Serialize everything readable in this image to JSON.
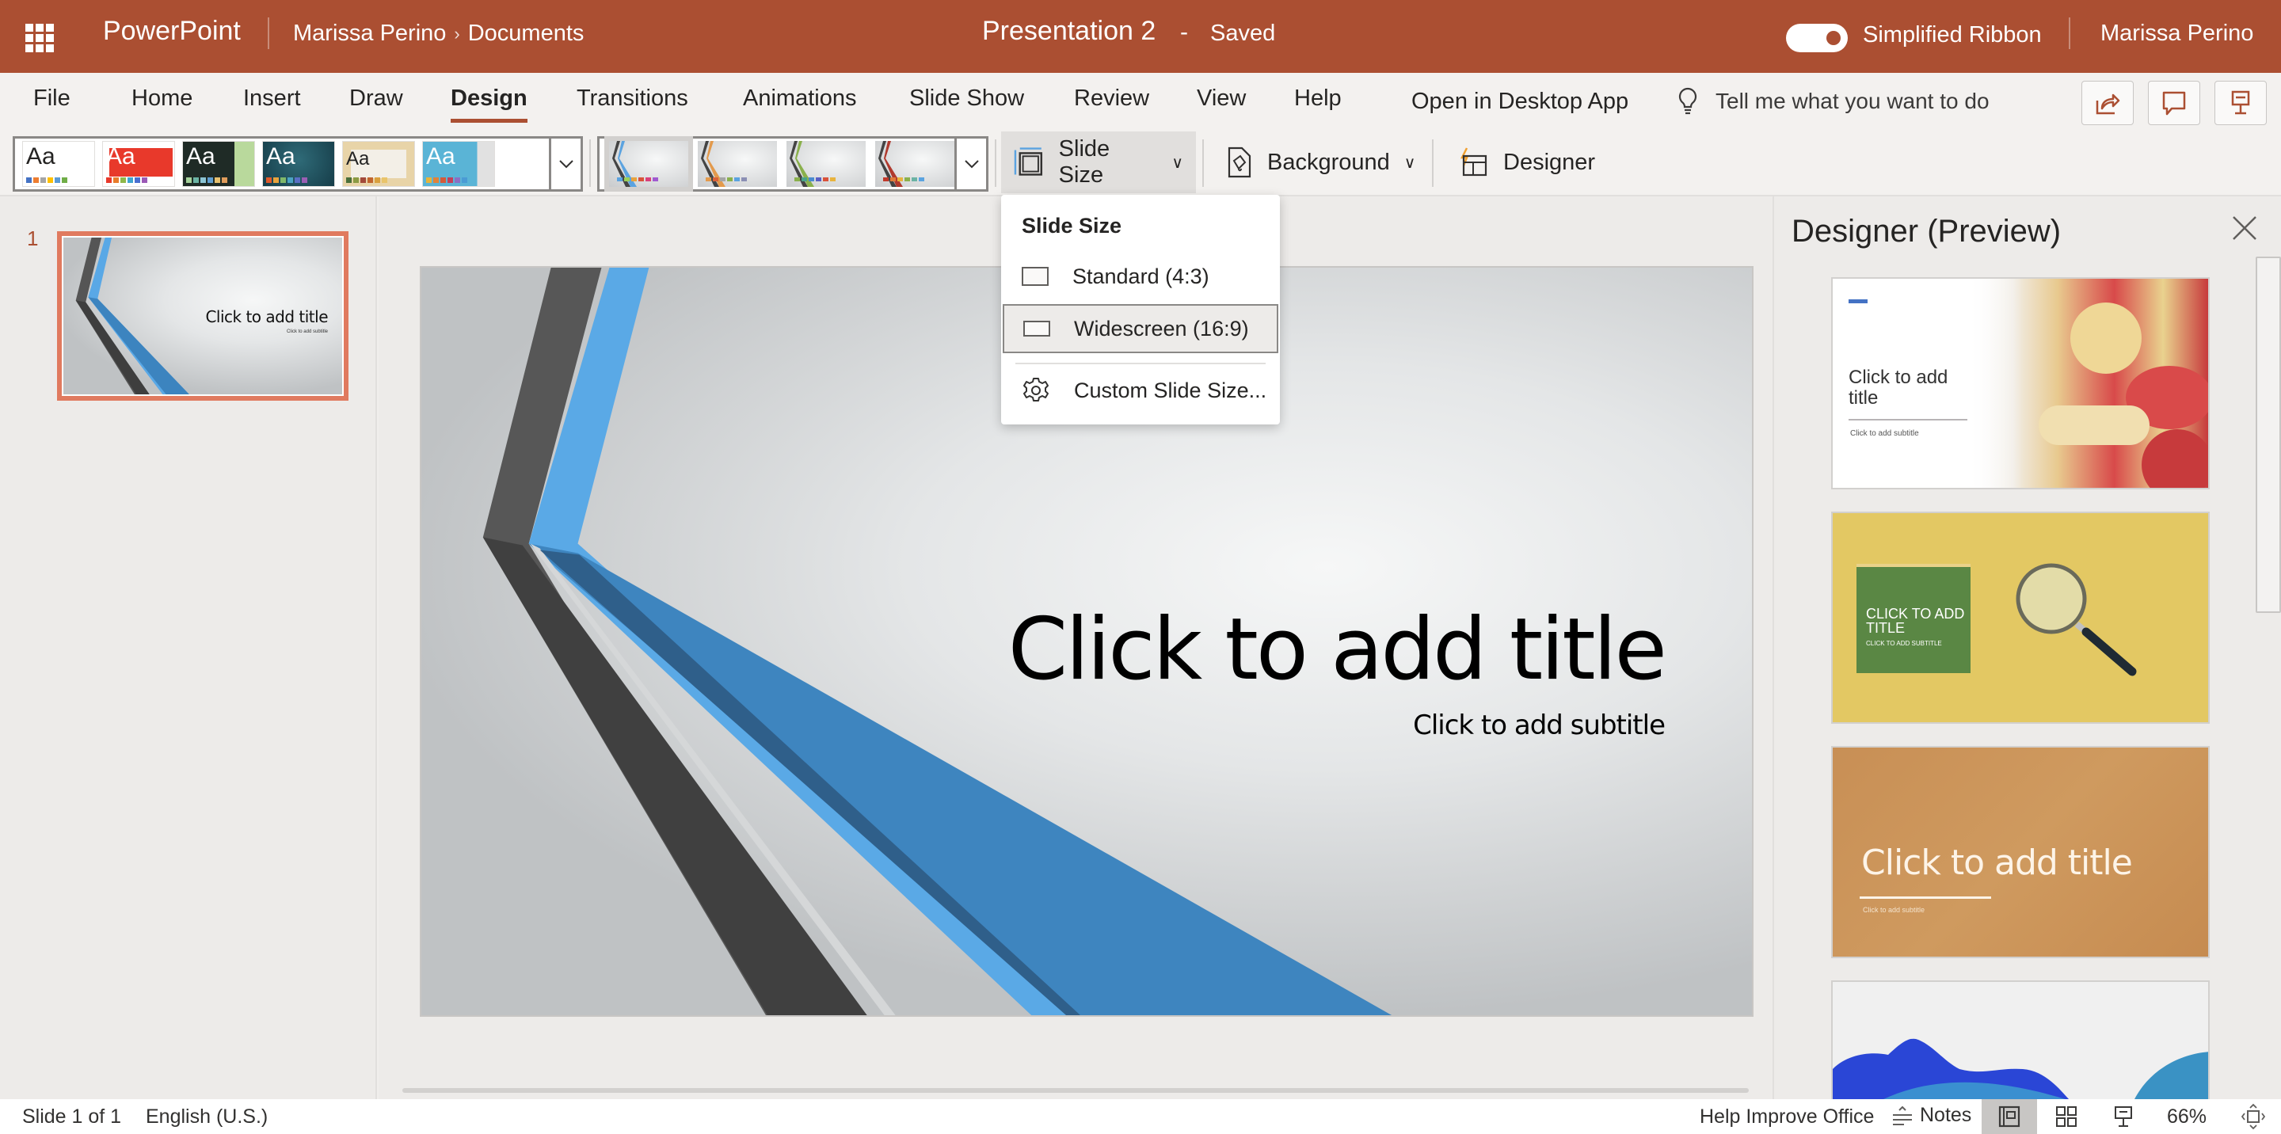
{
  "titlebar": {
    "app_name": "PowerPoint",
    "breadcrumb": [
      "Marissa Perino",
      "Documents"
    ],
    "doc_title": "Presentation 2",
    "separator": "-",
    "save_status": "Saved",
    "simplified_ribbon_label": "Simplified Ribbon",
    "simplified_ribbon_on": true,
    "user_name": "Marissa Perino",
    "brand_color": "#ab4f32"
  },
  "tabs": {
    "items": [
      {
        "label": "File"
      },
      {
        "label": "Home"
      },
      {
        "label": "Insert"
      },
      {
        "label": "Draw"
      },
      {
        "label": "Design",
        "active": true
      },
      {
        "label": "Transitions"
      },
      {
        "label": "Animations"
      },
      {
        "label": "Slide Show"
      },
      {
        "label": "Review"
      },
      {
        "label": "View"
      },
      {
        "label": "Help"
      },
      {
        "label": "Open in Desktop App"
      }
    ],
    "tell_me_placeholder": "Tell me what you want to do",
    "right_buttons": [
      {
        "icon": "share-icon"
      },
      {
        "icon": "comments-icon"
      },
      {
        "icon": "present-icon"
      }
    ]
  },
  "ribbon": {
    "themes": [
      {
        "label": "Aa",
        "bg": "#ffffff",
        "fg": "#000000",
        "accent": "#ffffff",
        "swatches": [
          "#4472c4",
          "#ed7d31",
          "#a5a5a5",
          "#ffc000",
          "#5b9bd5",
          "#70ad47"
        ]
      },
      {
        "label": "Aa",
        "bg": "#ffffff",
        "fg": "#ffffff",
        "accent": "#e8392b",
        "swatches": [
          "#e8392b",
          "#e87b2b",
          "#8fb84a",
          "#3fa4d0",
          "#4a6fd0",
          "#9b59b6"
        ]
      },
      {
        "label": "Aa",
        "bg": "#1f2b26",
        "fg": "#ffffff",
        "accent": "#b9d99c",
        "swatches": [
          "#a5d29a",
          "#6bb3a4",
          "#8bc4d4",
          "#5f9ed1",
          "#e7c06e",
          "#e09c5b"
        ]
      },
      {
        "label": "Aa",
        "bg": "#1e4d5c",
        "fg": "#ffffff",
        "accent": "#c0392b",
        "swatches": [
          "#e05a2b",
          "#e8a33d",
          "#7fb86a",
          "#4aa3c4",
          "#5a6fc4",
          "#9a5fb4"
        ]
      },
      {
        "label": "Aa",
        "bg": "#e8d4a8",
        "fg": "#222222",
        "accent": "#ffffff",
        "swatches": [
          "#4a6f3a",
          "#8b9b44",
          "#a34a3a",
          "#c1652e",
          "#d9a03e",
          "#e9c46a"
        ]
      },
      {
        "label": "Aa",
        "bg": "#ffffff",
        "fg": "#ffffff",
        "accent": "#5ab4d6",
        "swatches": [
          "#e6b43a",
          "#e0823a",
          "#d45a3a",
          "#c4405a",
          "#8b6fc4",
          "#4a9bd4"
        ]
      }
    ],
    "variants": [
      {
        "accent": "#5ba3e0",
        "selected": true
      },
      {
        "accent": "#e39a4c"
      },
      {
        "accent": "#8ab04c"
      },
      {
        "accent": "#b03a2e"
      }
    ],
    "slide_size_label": "Slide Size",
    "background_label": "Background",
    "designer_label": "Designer"
  },
  "slide_size_menu": {
    "header": "Slide Size",
    "items": [
      {
        "label": "Standard (4:3)",
        "icon": "standard-ratio-icon",
        "selected": false
      },
      {
        "label": "Widescreen (16:9)",
        "icon": "widescreen-ratio-icon",
        "selected": true
      },
      {
        "label": "Custom Slide Size...",
        "icon": "gear-icon",
        "selected": false
      }
    ]
  },
  "slides_panel": {
    "slides": [
      {
        "number": "1",
        "title": "Click to add title",
        "subtitle": "Click to add subtitle"
      }
    ]
  },
  "slide": {
    "title_placeholder": "Click to add title",
    "subtitle_placeholder": "Click to add subtitle"
  },
  "designer": {
    "title": "Designer (Preview)",
    "cards": [
      {
        "title": "Click to add title",
        "subtitle": "Click to add subtitle"
      },
      {
        "title": "CLICK TO ADD TITLE",
        "subtitle": "CLICK TO ADD SUBTITLE"
      },
      {
        "title": "Click to add title",
        "subtitle": "Click to add subtitle"
      },
      {
        "title": "",
        "subtitle": ""
      }
    ]
  },
  "statusbar": {
    "slide_position": "Slide 1 of 1",
    "language": "English (U.S.)",
    "help_improve": "Help Improve Office",
    "notes_label": "Notes",
    "zoom": "66%"
  }
}
